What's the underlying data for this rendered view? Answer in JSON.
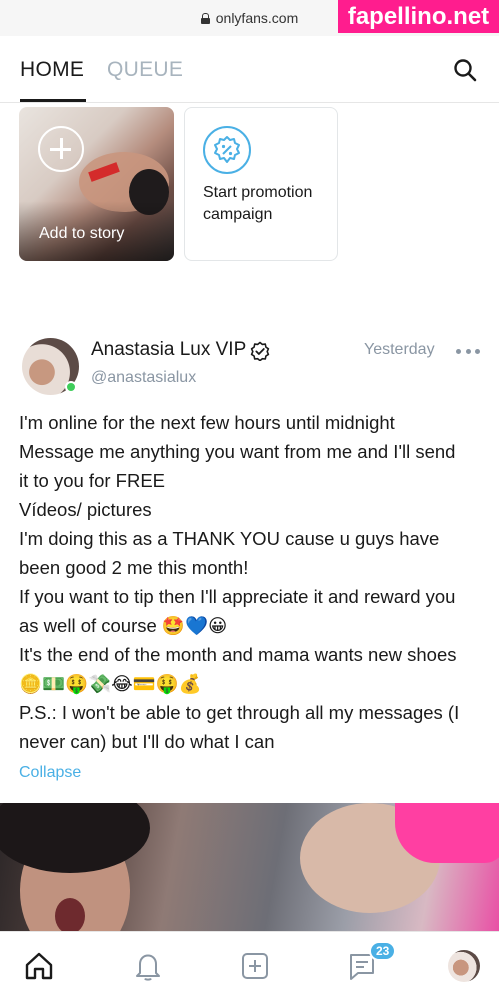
{
  "browser": {
    "url": "onlyfans.com",
    "watermark": "fapellino.net"
  },
  "topnav": {
    "tabs": [
      {
        "label": "HOME",
        "active": true
      },
      {
        "label": "QUEUE",
        "active": false
      }
    ],
    "search_icon": "search-icon"
  },
  "stories": {
    "add_label": "Add to story",
    "promo_label": "Start promotion campaign",
    "promo_icon": "percent-badge-icon"
  },
  "post": {
    "author": "Anastasia Lux VIP",
    "handle": "@anastasialux",
    "time": "Yesterday",
    "online": true,
    "lines": [
      "I'm online for the next few hours until midnight",
      "Message me anything you want from me and I'll send",
      "it to you for FREE",
      "Vídeos/ pictures",
      "I'm doing this as a THANK YOU cause u guys have",
      "been good 2 me this month!",
      "If you want to tip then I'll appreciate it and reward you",
      "as well of course 🤩💙😀",
      "It's the end of the month and mama wants new shoes",
      "🪙💵🤑💸😂💳🤑💰",
      "P.S.: I won't be able to get through all my messages (I",
      "never can) but I'll do what I can"
    ],
    "collapse_label": "Collapse"
  },
  "bottomnav": {
    "items": [
      "home-icon",
      "bell-icon",
      "plus-square-icon",
      "message-icon",
      "profile-avatar"
    ],
    "message_badge": "23"
  },
  "colors": {
    "accent": "#4ab0e5",
    "muted": "#8a96a3",
    "online": "#3fcd5a",
    "watermark": "#ff1d8e"
  }
}
